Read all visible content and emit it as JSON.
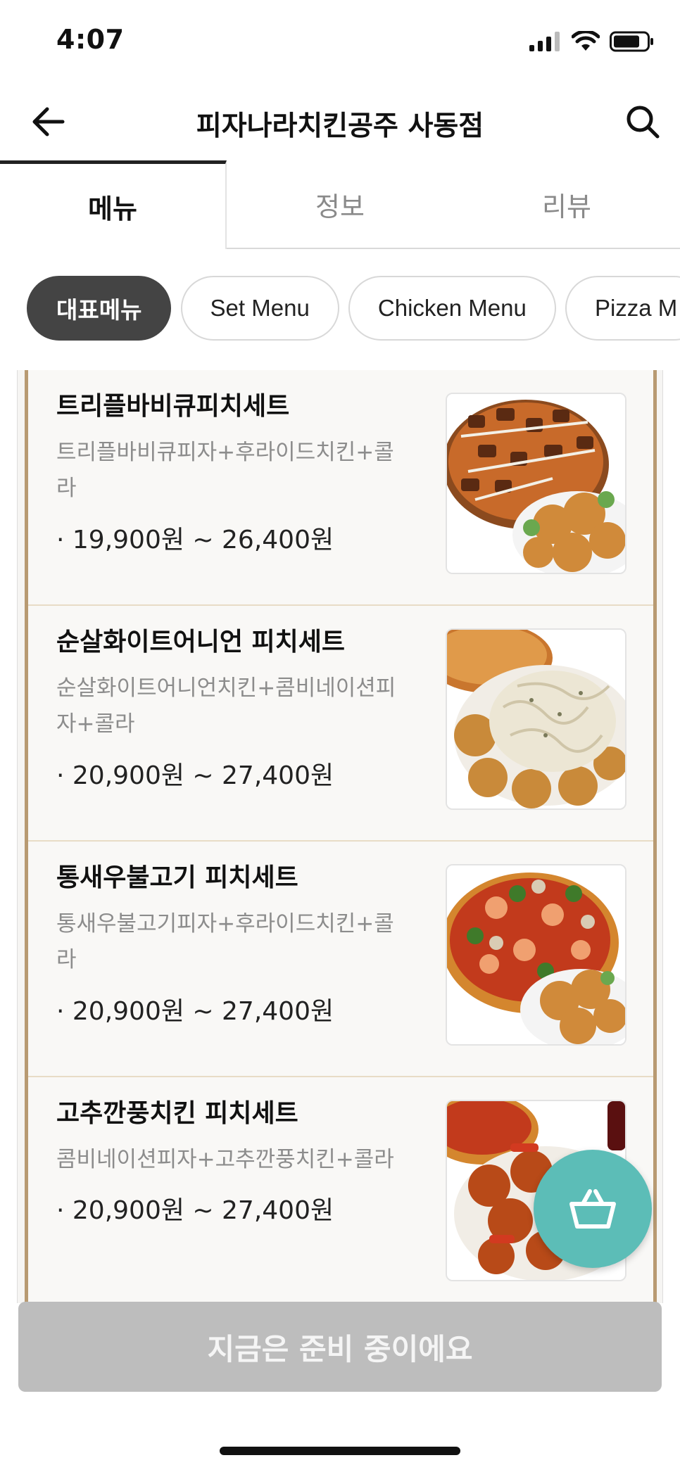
{
  "status": {
    "time": "4:07"
  },
  "header": {
    "title": "피자나라치킨공주 사동점"
  },
  "tabs": [
    {
      "label": "메뉴",
      "active": true
    },
    {
      "label": "정보",
      "active": false
    },
    {
      "label": "리뷰",
      "active": false
    }
  ],
  "categories": [
    {
      "label": "대표메뉴",
      "active": true
    },
    {
      "label": "Set Menu",
      "active": false
    },
    {
      "label": "Chicken Menu",
      "active": false
    },
    {
      "label": "Pizza M",
      "active": false
    }
  ],
  "menu_items": [
    {
      "name": "트리플바비큐피치세트",
      "desc_line1": "트리플바비큐피자+후라이드치킨+콜",
      "desc_line2": "라",
      "price": "· 19,900원 ~ 26,400원",
      "image": "pizza-with-fried-chicken"
    },
    {
      "name": "순살화이트어니언 피치세트",
      "desc_line1": "순살화이트어니언치킨+콤비네이션피",
      "desc_line2": "자+콜라",
      "price": "· 20,900원 ~ 27,400원",
      "image": "white-onion-boneless-chicken"
    },
    {
      "name": "통새우불고기 피치세트",
      "desc_line1": "통새우불고기피자+후라이드치킨+콜",
      "desc_line2": "라",
      "price": "· 20,900원 ~ 27,400원",
      "image": "shrimp-bulgogi-pizza-with-chicken"
    },
    {
      "name": "고추깐풍치킨 피치세트",
      "desc_line1": "콤비네이션피자+고추깐풍치킨+콜라",
      "desc_line2": "",
      "price": "· 20,900원 ~ 27,400원",
      "image": "kkanpung-chicken-with-pizza"
    }
  ],
  "order_bar": {
    "label": "지금은 준비 중이에요"
  },
  "colors": {
    "accent": "#5cbdb7",
    "active_chip": "#444444",
    "frame": "#b89a72",
    "disabled": "#bdbdbd"
  }
}
